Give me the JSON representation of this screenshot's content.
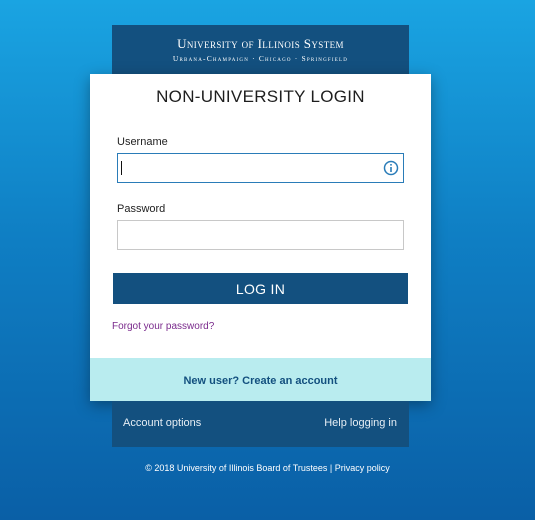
{
  "header": {
    "brand_main": "University of Illinois System",
    "brand_sub": "Urbana-Champaign · Chicago · Springfield"
  },
  "form": {
    "title": "NON-UNIVERSITY LOGIN",
    "username_label": "Username",
    "username_value": "",
    "password_label": "Password",
    "password_value": "",
    "login_label": "LOG IN",
    "forgot_label": "Forgot your password?",
    "new_user_label": "New user? Create an account"
  },
  "footer": {
    "account_options": "Account options",
    "help": "Help logging in",
    "copyright": "© 2018 University of Illinois Board of Trustees",
    "separator": "|",
    "privacy": "Privacy policy"
  },
  "icons": {
    "info": "info-icon"
  },
  "colors": {
    "brand_navy": "#13507f",
    "field_focus": "#2a7cb8",
    "new_user_bg": "#b9ecef",
    "link_purple": "#7a2a8c"
  }
}
